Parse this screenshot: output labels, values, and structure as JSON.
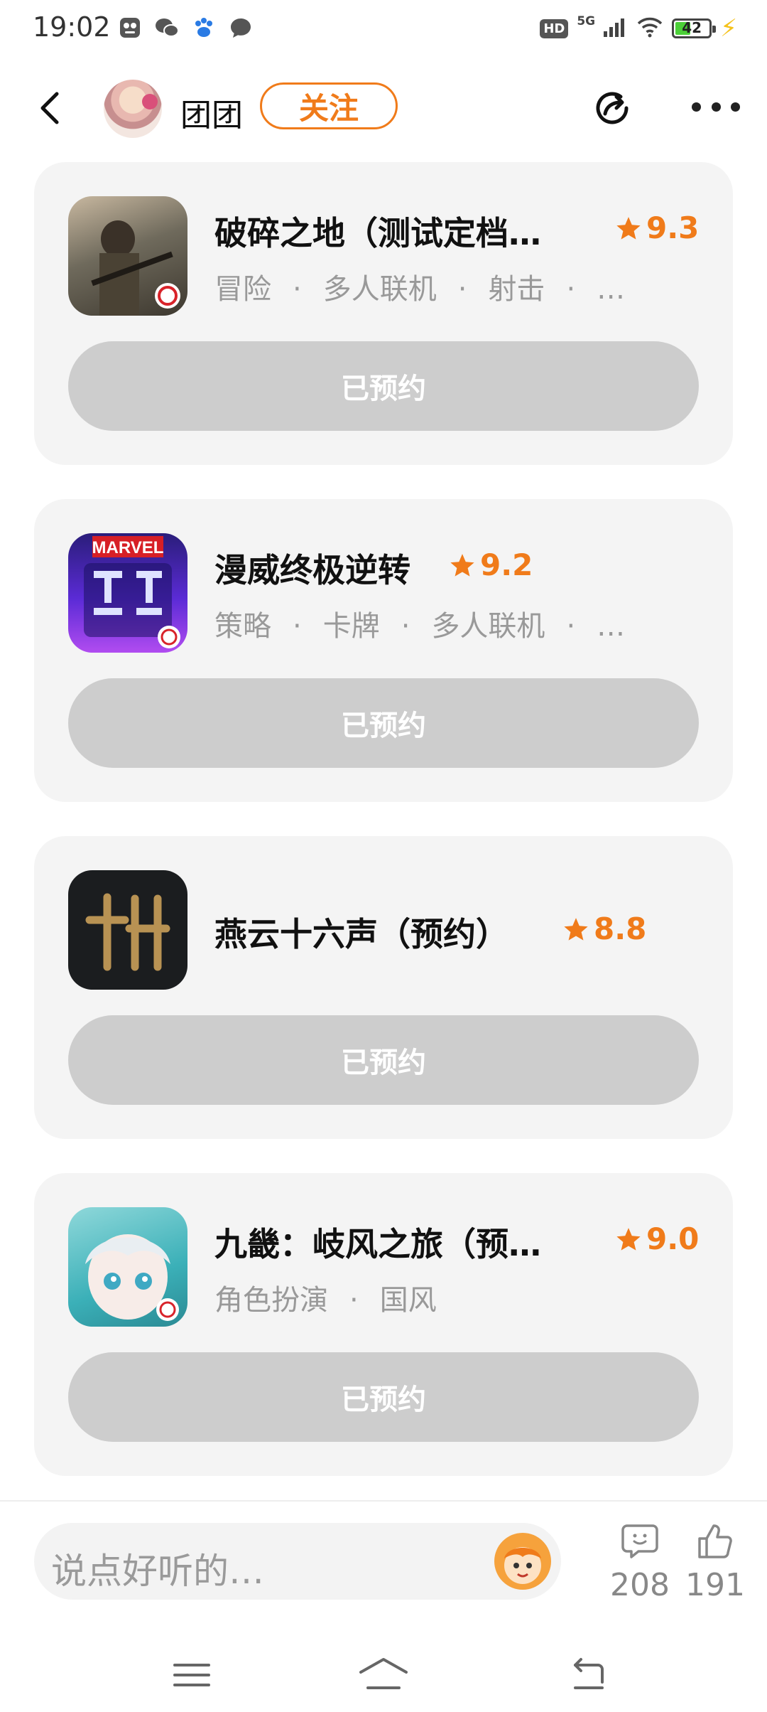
{
  "status_bar": {
    "time": "19:02",
    "hd": "HD",
    "network": "5G",
    "battery": "42",
    "icons": [
      "scan-app-icon",
      "wechat-icon",
      "baidu-icon",
      "message-icon",
      "signal-icon",
      "wifi-icon",
      "charging-icon"
    ]
  },
  "header": {
    "back_icon": "back-arrow-icon",
    "user_name": "团团",
    "follow_label": "关注",
    "share_icon": "share-icon",
    "more_icon": "more-icon"
  },
  "games": [
    {
      "title": "破碎之地（测试定档…",
      "rating": "9.3",
      "tags": [
        "冒险",
        "多人联机",
        "射击",
        "…"
      ],
      "button": "已预约"
    },
    {
      "title": "漫威终极逆转",
      "rating": "9.2",
      "tags": [
        "策略",
        "卡牌",
        "多人联机",
        "…"
      ],
      "button": "已预约"
    },
    {
      "title": "燕云十六声（预约）",
      "rating": "8.8",
      "tags": [],
      "button": "已预约"
    },
    {
      "title": "九畿：岐风之旅（预…",
      "rating": "9.0",
      "tags": [
        "角色扮演",
        "国风"
      ],
      "button": "已预约"
    }
  ],
  "comment_bar": {
    "placeholder": "说点好听的…",
    "comment_count": "208",
    "like_count": "191"
  },
  "navbar": {
    "items": [
      "menu-icon",
      "home-icon",
      "back-icon"
    ]
  },
  "colors": {
    "accent": "#f07b1a",
    "card_bg": "#f4f4f4",
    "button_disabled": "#cdcdcd"
  }
}
